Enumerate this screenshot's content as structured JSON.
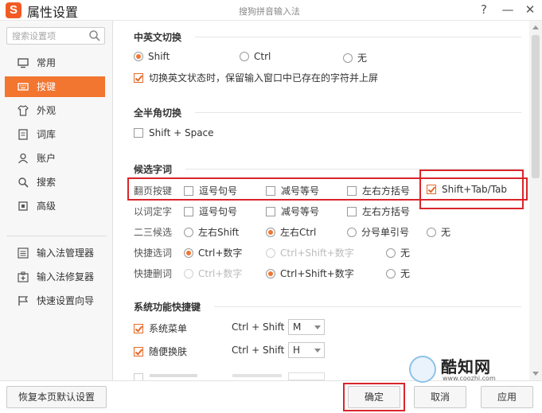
{
  "window": {
    "title": "属性设置",
    "app_title": "搜狗拼音输入法",
    "help": "?",
    "minimize": "—",
    "close": "✕",
    "logo_letter": "S"
  },
  "sidebar": {
    "search_placeholder": "搜索设置项",
    "items": [
      {
        "label": "常用",
        "icon": "monitor-icon"
      },
      {
        "label": "按键",
        "icon": "keyboard-icon",
        "active": true
      },
      {
        "label": "外观",
        "icon": "shirt-icon"
      },
      {
        "label": "词库",
        "icon": "book-icon"
      },
      {
        "label": "账户",
        "icon": "user-icon"
      },
      {
        "label": "搜索",
        "icon": "search-icon"
      },
      {
        "label": "高级",
        "icon": "advanced-icon"
      }
    ],
    "tools": [
      {
        "label": "输入法管理器",
        "icon": "list-icon"
      },
      {
        "label": "输入法修复器",
        "icon": "repair-icon"
      },
      {
        "label": "快速设置向导",
        "icon": "flag-icon"
      }
    ]
  },
  "sections": {
    "cn_en": {
      "title": "中英文切换",
      "options": [
        "Shift",
        "Ctrl",
        "无"
      ],
      "selected": "Shift",
      "keep_text_label": "切换英文状态时，保留输入窗口中已存在的字符并上屏",
      "keep_text_checked": true
    },
    "full_half": {
      "title": "全半角切换",
      "option": "Shift + Space",
      "checked": false
    },
    "candidates": {
      "title": "候选字词",
      "page_row": {
        "label": "翻页按键",
        "options": [
          {
            "label": "逗号句号",
            "checked": false
          },
          {
            "label": "减号等号",
            "checked": false
          },
          {
            "label": "左右方括号",
            "checked": false
          },
          {
            "label": "Shift+Tab/Tab",
            "checked": true
          }
        ]
      },
      "word_row": {
        "label": "以词定字",
        "options": [
          {
            "label": "逗号句号",
            "checked": false
          },
          {
            "label": "减号等号",
            "checked": false
          },
          {
            "label": "左右方括号",
            "checked": false
          }
        ]
      },
      "second_third_row": {
        "label": "二三候选",
        "options": [
          "左右Shift",
          "左右Ctrl",
          "分号单引号",
          "无"
        ],
        "selected": "左右Ctrl"
      },
      "quick_select_row": {
        "label": "快捷选词",
        "options": [
          "Ctrl+数字",
          "Ctrl+Shift+数字",
          "无"
        ],
        "selected": "Ctrl+数字"
      },
      "quick_delete_row": {
        "label": "快捷删词",
        "options": [
          "Ctrl+数字",
          "Ctrl+Shift+数字",
          "无"
        ],
        "selected": "Ctrl+Shift+数字"
      }
    },
    "system_hotkeys": {
      "title": "系统功能快捷键",
      "rows": [
        {
          "label": "系统菜单",
          "checked": true,
          "combo": "Ctrl + Shift +",
          "key": "M"
        },
        {
          "label": "随便换肤",
          "checked": true,
          "combo": "Ctrl + Shift +",
          "key": "H"
        }
      ]
    }
  },
  "footer": {
    "reset_label": "恢复本页默认设置",
    "ok_label": "确定",
    "cancel_label": "取消",
    "apply_label": "应用"
  },
  "watermark": {
    "brand": "酷知网",
    "url": "www.coozhi.com"
  },
  "colors": {
    "accent": "#f27530",
    "highlight_border": "#d9262b"
  }
}
